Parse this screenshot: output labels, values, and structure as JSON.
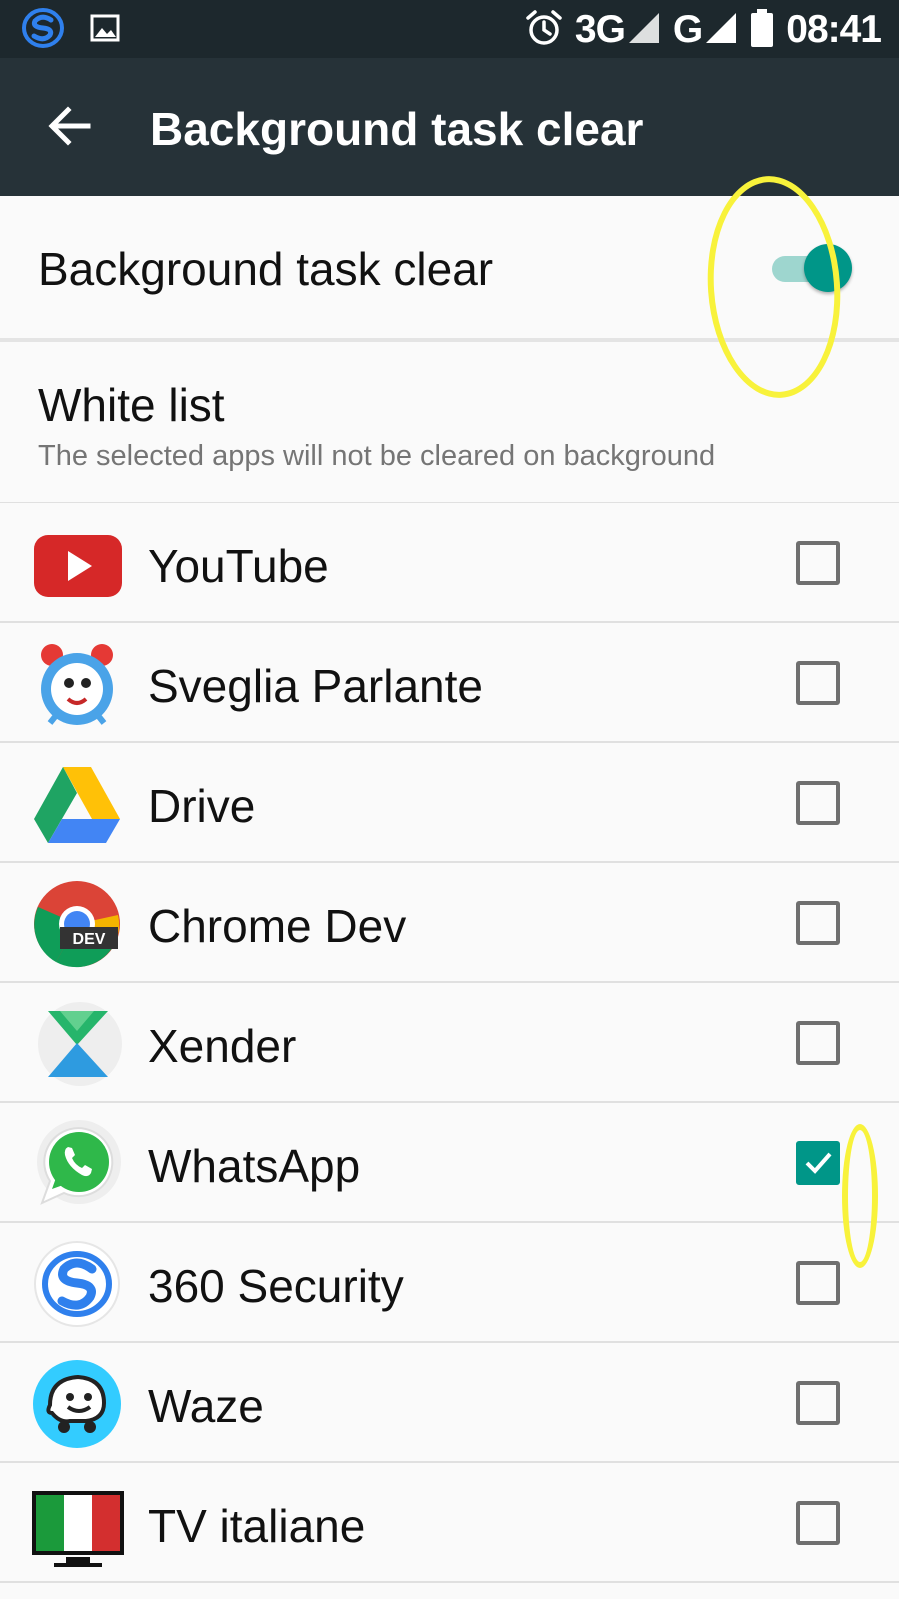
{
  "status_bar": {
    "network_1": "3G",
    "network_2": "G",
    "time": "08:41",
    "icons": [
      "360-security-icon",
      "image-icon",
      "alarm-icon",
      "signal-icon",
      "signal-icon",
      "battery-icon"
    ]
  },
  "app_bar": {
    "title": "Background task clear",
    "back_icon": "arrow-left-icon"
  },
  "toggle": {
    "label": "Background task clear",
    "state": "on",
    "accent_color": "#009688"
  },
  "white_list": {
    "title": "White list",
    "subtitle": "The selected apps will not be cleared on background"
  },
  "apps": [
    {
      "name": "YouTube",
      "icon": "youtube-icon",
      "checked": false
    },
    {
      "name": "Sveglia Parlante",
      "icon": "alarm-clock-icon",
      "checked": false
    },
    {
      "name": "Drive",
      "icon": "drive-icon",
      "checked": false
    },
    {
      "name": "Chrome Dev",
      "icon": "chrome-dev-icon",
      "checked": false,
      "icon_badge": "DEV"
    },
    {
      "name": "Xender",
      "icon": "xender-icon",
      "checked": false
    },
    {
      "name": "WhatsApp",
      "icon": "whatsapp-icon",
      "checked": true
    },
    {
      "name": "360 Security",
      "icon": "360-security-icon",
      "checked": false
    },
    {
      "name": "Waze",
      "icon": "waze-icon",
      "checked": false
    },
    {
      "name": "TV italiane",
      "icon": "italian-flag-tv-icon",
      "checked": false
    }
  ],
  "colors": {
    "status_bar": "#1d282d",
    "app_bar": "#263238",
    "accent": "#009688",
    "annotation": "#f8f23b"
  }
}
